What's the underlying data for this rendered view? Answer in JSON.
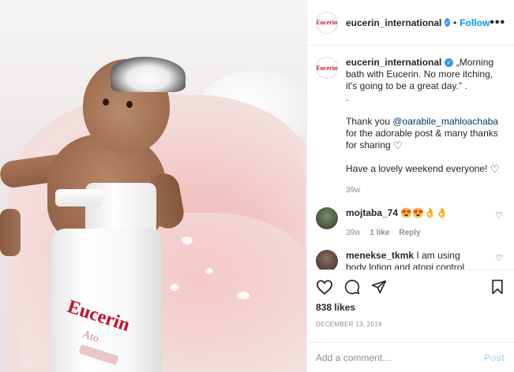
{
  "header": {
    "username": "eucerin_international",
    "follow_label": "Follow",
    "separator": "•",
    "more_label": "•••",
    "avatar_text": "Eucerin"
  },
  "photo": {
    "bottle_brand": "Eucerin",
    "bottle_sub": "Ato"
  },
  "caption": {
    "username": "eucerin_international",
    "line1": " „Morning bath with Eucerin. No more itching, it's going to be a great day.\" .",
    "line2": ".",
    "line3_prefix": "Thank you ",
    "mention": "@oarabile_mahloachaba",
    "line3_suffix": " for the adorable post & many thanks for sharing ",
    "line4": "Have a lovely weekend everyone! ",
    "heart": "♡",
    "time": "39w"
  },
  "comments": [
    {
      "username": "mojtaba_74",
      "text": " 😍😍👌👌",
      "time": "39w",
      "likes": "1 like",
      "reply": "Reply"
    },
    {
      "username": "menekse_tkmk",
      "text": " I am using body lotion and atopi control cream but my baby still itching and his",
      "time": "",
      "likes": "",
      "reply": ""
    }
  ],
  "actions": {
    "likes": "838 likes",
    "date": "DECEMBER 13, 2019"
  },
  "add_comment": {
    "placeholder": "Add a comment…",
    "post_label": "Post"
  },
  "colors": {
    "follow": "#0095f6",
    "verified": "#3897f0",
    "brand_red": "#c8102e",
    "post_disabled": "#b2dffc"
  }
}
